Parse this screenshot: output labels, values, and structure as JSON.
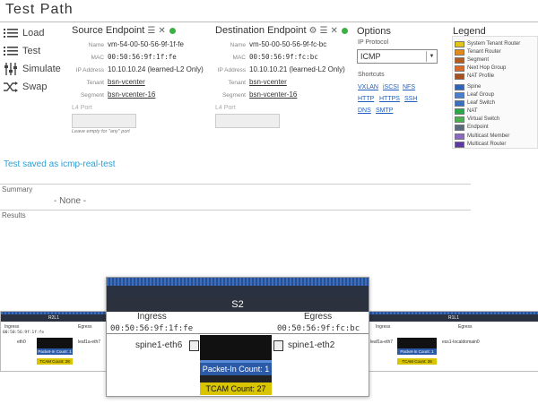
{
  "page": {
    "title": "Test Path"
  },
  "actions": [
    {
      "label": "Load",
      "icon": "list-icon"
    },
    {
      "label": "Test",
      "icon": "list-icon"
    },
    {
      "label": "Simulate",
      "icon": "sliders-icon"
    },
    {
      "label": "Swap",
      "icon": "shuffle-icon"
    }
  ],
  "source": {
    "title": "Source Endpoint",
    "name_label": "Name",
    "name": "vm-54-00-50-56-9f-1f-fe",
    "mac_label": "MAC",
    "mac": "00:50:56:9f:1f:fe",
    "ip_label": "IP Address",
    "ip": "10.10.10.24 (learned-L2 Only)",
    "tenant_label": "Tenant",
    "tenant": "bsn-vcenter",
    "segment_label": "Segment",
    "segment": "bsn-vcenter-16",
    "l4_label": "L4 Port",
    "l4_value": "",
    "l4_note": "Leave empty for \"any\" port"
  },
  "destination": {
    "title": "Destination Endpoint",
    "name_label": "Name",
    "name": "vm-50-00-50-56-9f-fc-bc",
    "mac_label": "MAC",
    "mac": "00:50:56:9f:fc:bc",
    "ip_label": "IP Address",
    "ip": "10.10.10.21 (learned-L2 Only)",
    "tenant_label": "Tenant",
    "tenant": "bsn-vcenter",
    "segment_label": "Segment",
    "segment": "bsn-vcenter-16",
    "l4_label": "L4 Port",
    "l4_value": ""
  },
  "options": {
    "title": "Options",
    "protocol_label": "IP Protocol",
    "protocol_value": "ICMP",
    "shortcuts_label": "Shortcuts",
    "shortcuts": [
      [
        "VXLAN",
        "iSCSI",
        "NFS"
      ],
      [
        "HTTP",
        "HTTPS",
        "SSH"
      ],
      [
        "DNS",
        "SMTP"
      ]
    ]
  },
  "legend": {
    "title": "Legend",
    "items": [
      {
        "label": "System Tenant Router",
        "color": "#e3c51a"
      },
      {
        "label": "Tenant Router",
        "color": "#e38a1a"
      },
      {
        "label": "Segment",
        "color": "#b35c1f"
      },
      {
        "label": "Next Hop Group",
        "color": "#d96a2a"
      },
      {
        "label": "NAT Profile",
        "color": "#a8501e"
      },
      {
        "label": "Spine",
        "color": "#2d63b8"
      },
      {
        "label": "Leaf Group",
        "color": "#4a7fd0"
      },
      {
        "label": "Leaf Switch",
        "color": "#3a6fc0"
      },
      {
        "label": "NAT",
        "color": "#2aa84a"
      },
      {
        "label": "Virtual Switch",
        "color": "#4caf50"
      },
      {
        "label": "Endpoint",
        "color": "#5a6a7a"
      },
      {
        "label": "Multicast Member",
        "color": "#8a6ac0"
      },
      {
        "label": "Multicast Router",
        "color": "#5a3aa0"
      }
    ]
  },
  "status": {
    "saved": "Test saved as icmp-real-test"
  },
  "summary": {
    "label": "Summary",
    "value": "- None -"
  },
  "results": {
    "label": "Results",
    "left_switch": {
      "name": "R2L1",
      "ingress": "Ingress",
      "egress": "Egress",
      "ingress_mac": "00:50:56:9f:1f:fe",
      "in_port": "eth0",
      "out_port": "leaf1a-eth7",
      "packet_in": "Packet-In Count: 1",
      "tcam": "TCAM Count: 28"
    },
    "center_switch": {
      "name": "S2",
      "ingress": "Ingress",
      "egress": "Egress",
      "ingress_mac": "00:50:56:9f:1f:fe",
      "egress_mac": "00:50:56:9f:fc:bc",
      "in_port": "spine1-eth6",
      "out_port": "spine1-eth2",
      "packet_in": "Packet-In Count: 1",
      "tcam": "TCAM Count: 27"
    },
    "right_switch": {
      "name": "R1L1",
      "ingress": "Ingress",
      "egress": "Egress",
      "in_port": "leaf1a-eth7",
      "out_port": "ess1-localdomain0",
      "packet_in": "Packet-In Count: 1",
      "tcam": "TCAM Count: 28"
    }
  }
}
